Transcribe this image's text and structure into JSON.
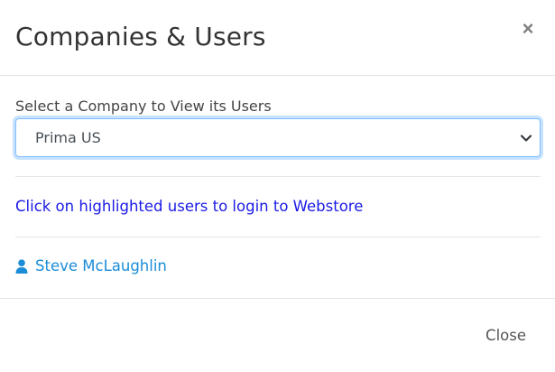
{
  "dialog": {
    "title": "Companies & Users",
    "close_icon_glyph": "×",
    "close_icon": "close-icon"
  },
  "company_select": {
    "label": "Select a Company to View its Users",
    "selected_value": "Prima US",
    "chevron_icon": "chevron-down-icon"
  },
  "hint": {
    "text": "Click on highlighted users to login to Webstore"
  },
  "users": [
    {
      "name": "Steve McLaughlin",
      "icon": "user-icon"
    }
  ],
  "footer": {
    "close_label": "Close"
  },
  "colors": {
    "hint_text": "#1a1ae6",
    "user_link": "#1a8cd8",
    "focus_border": "#80bdff"
  }
}
